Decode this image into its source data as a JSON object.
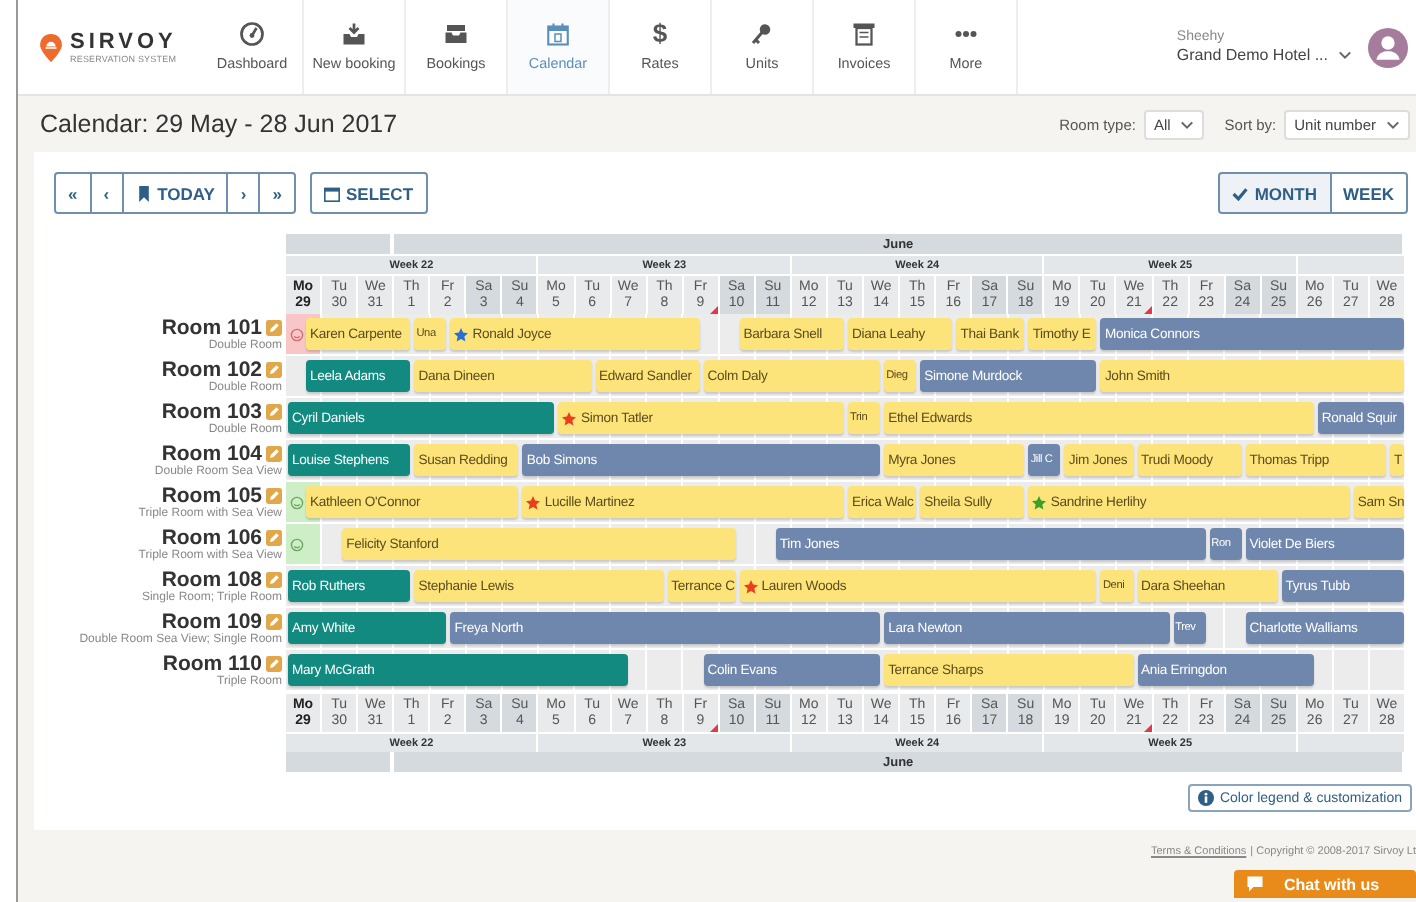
{
  "logo": {
    "name": "SIRVOY",
    "tagline": "RESERVATION SYSTEM"
  },
  "nav": [
    {
      "label": "Dashboard",
      "selected": false
    },
    {
      "label": "New booking",
      "selected": false
    },
    {
      "label": "Bookings",
      "selected": false
    },
    {
      "label": "Calendar",
      "selected": true
    },
    {
      "label": "Rates",
      "glyph": "$",
      "selected": false
    },
    {
      "label": "Units",
      "selected": false
    },
    {
      "label": "Invoices",
      "selected": false
    },
    {
      "label": "More",
      "selected": false
    }
  ],
  "user": {
    "name": "Sheehy",
    "hotel": "Grand Demo Hotel ..."
  },
  "page_title": "Calendar: 29 May - 28 Jun 2017",
  "filters": [
    {
      "label": "Room type:",
      "value": "All"
    },
    {
      "label": "Sort by:",
      "value": "Unit number"
    }
  ],
  "toolbar": {
    "first": "«",
    "prev": "‹",
    "today": "TODAY",
    "next": "›",
    "last": "»",
    "select": "SELECT"
  },
  "views": [
    {
      "label": "MONTH",
      "selected": true
    },
    {
      "label": "WEEK",
      "selected": false
    }
  ],
  "header": {
    "months": [
      {
        "label": "June"
      }
    ],
    "weeks": [
      {
        "label": "Week 22"
      },
      {
        "label": "Week 23"
      },
      {
        "label": "Week 24"
      },
      {
        "label": "Week 25"
      }
    ],
    "days": [
      {
        "abbr": "Mo",
        "num": "29",
        "weekend": false,
        "today": true,
        "flag": false
      },
      {
        "abbr": "Tu",
        "num": "30",
        "weekend": false,
        "today": false,
        "flag": false
      },
      {
        "abbr": "We",
        "num": "31",
        "weekend": false,
        "today": false,
        "flag": false
      },
      {
        "abbr": "Th",
        "num": "1",
        "weekend": false,
        "today": false,
        "flag": false
      },
      {
        "abbr": "Fr",
        "num": "2",
        "weekend": false,
        "today": false,
        "flag": false
      },
      {
        "abbr": "Sa",
        "num": "3",
        "weekend": true,
        "today": false,
        "flag": false
      },
      {
        "abbr": "Su",
        "num": "4",
        "weekend": true,
        "today": false,
        "flag": false
      },
      {
        "abbr": "Mo",
        "num": "5",
        "weekend": false,
        "today": false,
        "flag": false
      },
      {
        "abbr": "Tu",
        "num": "6",
        "weekend": false,
        "today": false,
        "flag": false
      },
      {
        "abbr": "We",
        "num": "7",
        "weekend": false,
        "today": false,
        "flag": false
      },
      {
        "abbr": "Th",
        "num": "8",
        "weekend": false,
        "today": false,
        "flag": false
      },
      {
        "abbr": "Fr",
        "num": "9",
        "weekend": false,
        "today": false,
        "flag": true
      },
      {
        "abbr": "Sa",
        "num": "10",
        "weekend": true,
        "today": false,
        "flag": false
      },
      {
        "abbr": "Su",
        "num": "11",
        "weekend": true,
        "today": false,
        "flag": false
      },
      {
        "abbr": "Mo",
        "num": "12",
        "weekend": false,
        "today": false,
        "flag": false
      },
      {
        "abbr": "Tu",
        "num": "13",
        "weekend": false,
        "today": false,
        "flag": false
      },
      {
        "abbr": "We",
        "num": "14",
        "weekend": false,
        "today": false,
        "flag": false
      },
      {
        "abbr": "Th",
        "num": "15",
        "weekend": false,
        "today": false,
        "flag": false
      },
      {
        "abbr": "Fr",
        "num": "16",
        "weekend": false,
        "today": false,
        "flag": false
      },
      {
        "abbr": "Sa",
        "num": "17",
        "weekend": true,
        "today": false,
        "flag": false
      },
      {
        "abbr": "Su",
        "num": "18",
        "weekend": true,
        "today": false,
        "flag": false
      },
      {
        "abbr": "Mo",
        "num": "19",
        "weekend": false,
        "today": false,
        "flag": false
      },
      {
        "abbr": "Tu",
        "num": "20",
        "weekend": false,
        "today": false,
        "flag": false
      },
      {
        "abbr": "We",
        "num": "21",
        "weekend": false,
        "today": false,
        "flag": true
      },
      {
        "abbr": "Th",
        "num": "22",
        "weekend": false,
        "today": false,
        "flag": false
      },
      {
        "abbr": "Fr",
        "num": "23",
        "weekend": false,
        "today": false,
        "flag": false
      },
      {
        "abbr": "Sa",
        "num": "24",
        "weekend": true,
        "today": false,
        "flag": false
      },
      {
        "abbr": "Su",
        "num": "25",
        "weekend": true,
        "today": false,
        "flag": false
      },
      {
        "abbr": "Mo",
        "num": "26",
        "weekend": false,
        "today": false,
        "flag": false
      },
      {
        "abbr": "Tu",
        "num": "27",
        "weekend": false,
        "today": false,
        "flag": false
      },
      {
        "abbr": "We",
        "num": "28",
        "weekend": false,
        "today": false,
        "flag": false
      }
    ]
  },
  "rooms": [
    {
      "name": "Room 101",
      "type": "Double Room",
      "marker": {
        "clean": false
      },
      "bookings": [
        {
          "guest": "Karen Carpente",
          "color": "#fde47a"
        },
        {
          "guest": "Una",
          "color": "#fde47a"
        },
        {
          "guest": "Ronald Joyce",
          "color": "#fde47a",
          "star": {
            "color": "#2a6fd6"
          }
        },
        {
          "guest": "Barbara Snell",
          "color": "#fde47a"
        },
        {
          "guest": "Diana Leahy",
          "color": "#fde47a"
        },
        {
          "guest": "Thai Bank",
          "color": "#fde47a"
        },
        {
          "guest": "Timothy E",
          "color": "#fde47a"
        },
        {
          "guest": "Monica Connors",
          "color": "#6f87ad"
        }
      ]
    },
    {
      "name": "Room 102",
      "type": "Double Room",
      "bookings": [
        {
          "guest": "Leela Adams",
          "color": "#138a80"
        },
        {
          "guest": "Dana Dineen",
          "color": "#fde47a"
        },
        {
          "guest": "Edward Sandler",
          "color": "#fde47a"
        },
        {
          "guest": "Colm Daly",
          "color": "#fde47a"
        },
        {
          "guest": "Dieg",
          "color": "#fde47a"
        },
        {
          "guest": "Simone Murdock",
          "color": "#6f87ad"
        },
        {
          "guest": "John Smith",
          "color": "#fde47a"
        }
      ]
    },
    {
      "name": "Room 103",
      "type": "Double Room",
      "bookings": [
        {
          "guest": "Cyril Daniels",
          "color": "#138a80"
        },
        {
          "guest": "Simon Tatler",
          "color": "#fde47a",
          "star": {
            "color": "#e8401c"
          }
        },
        {
          "guest": "Trin",
          "color": "#fde47a"
        },
        {
          "guest": "Ethel Edwards",
          "color": "#fde47a"
        },
        {
          "guest": "Ronald Squir",
          "color": "#6f87ad"
        }
      ]
    },
    {
      "name": "Room 104",
      "type": "Double Room Sea View",
      "bookings": [
        {
          "guest": "Louise Stephens",
          "color": "#138a80"
        },
        {
          "guest": "Susan Redding",
          "color": "#fde47a"
        },
        {
          "guest": "Bob Simons",
          "color": "#6f87ad"
        },
        {
          "guest": "Myra Jones",
          "color": "#fde47a"
        },
        {
          "guest": "Jill C",
          "color": "#6f87ad"
        },
        {
          "guest": "Jim Jones",
          "color": "#fde47a"
        },
        {
          "guest": "Trudi Moody",
          "color": "#fde47a"
        },
        {
          "guest": "Thomas Tripp",
          "color": "#fde47a"
        },
        {
          "guest": "T",
          "color": "#fde47a"
        }
      ]
    },
    {
      "name": "Room 105",
      "type": "Triple Room with Sea View",
      "marker": {
        "clean": true
      },
      "bookings": [
        {
          "guest": "Kathleen O'Connor",
          "color": "#fde47a"
        },
        {
          "guest": "Lucille Martinez",
          "color": "#fde47a",
          "star": {
            "color": "#e8401c"
          }
        },
        {
          "guest": "Erica Walc",
          "color": "#fde47a"
        },
        {
          "guest": "Sheila Sully",
          "color": "#fde47a"
        },
        {
          "guest": "Sandrine Herlihy",
          "color": "#fde47a",
          "star": {
            "color": "#3aa02a"
          }
        },
        {
          "guest": "Sam Sn",
          "color": "#fde47a"
        }
      ]
    },
    {
      "name": "Room 106",
      "type": "Triple Room with Sea View",
      "marker": {
        "clean": true
      },
      "bookings": [
        {
          "guest": "Felicity Stanford",
          "color": "#fde47a"
        },
        {
          "guest": "Tim Jones",
          "color": "#6f87ad"
        },
        {
          "guest": "Ron",
          "color": "#6f87ad"
        },
        {
          "guest": "Violet De Biers",
          "color": "#6f87ad"
        }
      ]
    },
    {
      "name": "Room 108",
      "type": "Single Room; Triple Room",
      "bookings": [
        {
          "guest": "Rob Ruthers",
          "color": "#138a80"
        },
        {
          "guest": "Stephanie Lewis",
          "color": "#fde47a"
        },
        {
          "guest": "Terrance C",
          "color": "#fde47a"
        },
        {
          "guest": "Lauren Woods",
          "color": "#fde47a",
          "star": {
            "color": "#e8401c"
          }
        },
        {
          "guest": "Deni",
          "color": "#fde47a"
        },
        {
          "guest": "Dara Sheehan",
          "color": "#fde47a"
        },
        {
          "guest": "Tyrus Tubb",
          "color": "#6f87ad"
        }
      ]
    },
    {
      "name": "Room 109",
      "type": "Double Room Sea View; Single Room",
      "bookings": [
        {
          "guest": "Amy White",
          "color": "#138a80"
        },
        {
          "guest": "Freya North",
          "color": "#6f87ad"
        },
        {
          "guest": "Lara Newton",
          "color": "#6f87ad"
        },
        {
          "guest": "Trev",
          "color": "#6f87ad"
        },
        {
          "guest": "Charlotte Walliams",
          "color": "#6f87ad"
        }
      ]
    },
    {
      "name": "Room 110",
      "type": "Triple Room",
      "bookings": [
        {
          "guest": "Mary McGrath",
          "color": "#138a80"
        },
        {
          "guest": "Colin Evans",
          "color": "#6f87ad"
        },
        {
          "guest": "Terrance Sharps",
          "color": "#fde47a"
        },
        {
          "guest": "Ania Erringdon",
          "color": "#6f87ad"
        }
      ]
    }
  ],
  "footer_header": {
    "days": [
      {
        "abbr": "Mo",
        "num": "29",
        "weekend": false,
        "today": true,
        "flag": false
      },
      {
        "abbr": "Tu",
        "num": "30",
        "weekend": false,
        "today": false,
        "flag": false
      },
      {
        "abbr": "We",
        "num": "31",
        "weekend": false,
        "today": false,
        "flag": false
      },
      {
        "abbr": "Th",
        "num": "1",
        "weekend": false,
        "today": false,
        "flag": false
      },
      {
        "abbr": "Fr",
        "num": "2",
        "weekend": false,
        "today": false,
        "flag": false
      },
      {
        "abbr": "Sa",
        "num": "3",
        "weekend": true,
        "today": false,
        "flag": false
      },
      {
        "abbr": "Su",
        "num": "4",
        "weekend": true,
        "today": false,
        "flag": false
      },
      {
        "abbr": "Mo",
        "num": "5",
        "weekend": false,
        "today": false,
        "flag": false
      },
      {
        "abbr": "Tu",
        "num": "6",
        "weekend": false,
        "today": false,
        "flag": false
      },
      {
        "abbr": "We",
        "num": "7",
        "weekend": false,
        "today": false,
        "flag": false
      },
      {
        "abbr": "Th",
        "num": "8",
        "weekend": false,
        "today": false,
        "flag": false
      },
      {
        "abbr": "Fr",
        "num": "9",
        "weekend": false,
        "today": false,
        "flag": true
      },
      {
        "abbr": "Sa",
        "num": "10",
        "weekend": true,
        "today": false,
        "flag": false
      },
      {
        "abbr": "Su",
        "num": "11",
        "weekend": true,
        "today": false,
        "flag": false
      },
      {
        "abbr": "Mo",
        "num": "12",
        "weekend": false,
        "today": false,
        "flag": false
      },
      {
        "abbr": "Tu",
        "num": "13",
        "weekend": false,
        "today": false,
        "flag": false
      },
      {
        "abbr": "We",
        "num": "14",
        "weekend": false,
        "today": false,
        "flag": false
      },
      {
        "abbr": "Th",
        "num": "15",
        "weekend": false,
        "today": false,
        "flag": false
      },
      {
        "abbr": "Fr",
        "num": "16",
        "weekend": false,
        "today": false,
        "flag": false
      },
      {
        "abbr": "Sa",
        "num": "17",
        "weekend": true,
        "today": false,
        "flag": false
      },
      {
        "abbr": "Su",
        "num": "18",
        "weekend": true,
        "today": false,
        "flag": false
      },
      {
        "abbr": "Mo",
        "num": "19",
        "weekend": false,
        "today": false,
        "flag": false
      },
      {
        "abbr": "Tu",
        "num": "20",
        "weekend": false,
        "today": false,
        "flag": false
      },
      {
        "abbr": "We",
        "num": "21",
        "weekend": false,
        "today": false,
        "flag": true
      },
      {
        "abbr": "Th",
        "num": "22",
        "weekend": false,
        "today": false,
        "flag": false
      },
      {
        "abbr": "Fr",
        "num": "23",
        "weekend": false,
        "today": false,
        "flag": false
      },
      {
        "abbr": "Sa",
        "num": "24",
        "weekend": true,
        "today": false,
        "flag": false
      },
      {
        "abbr": "Su",
        "num": "25",
        "weekend": true,
        "today": false,
        "flag": false
      },
      {
        "abbr": "Mo",
        "num": "26",
        "weekend": false,
        "today": false,
        "flag": false
      },
      {
        "abbr": "Tu",
        "num": "27",
        "weekend": false,
        "today": false,
        "flag": false
      },
      {
        "abbr": "We",
        "num": "28",
        "weekend": false,
        "today": false,
        "flag": false
      }
    ],
    "weeks": [
      {
        "label": "Week 22"
      },
      {
        "label": "Week 23"
      },
      {
        "label": "Week 24"
      },
      {
        "label": "Week 25"
      }
    ],
    "months": [
      {
        "label": "June"
      }
    ]
  },
  "legend_button": "Color legend & customization",
  "footer": {
    "link": "Terms & Conditions",
    "copyright": "| Copyright © 2008-2017 Sirvoy Lt"
  },
  "chat": "Chat with us"
}
